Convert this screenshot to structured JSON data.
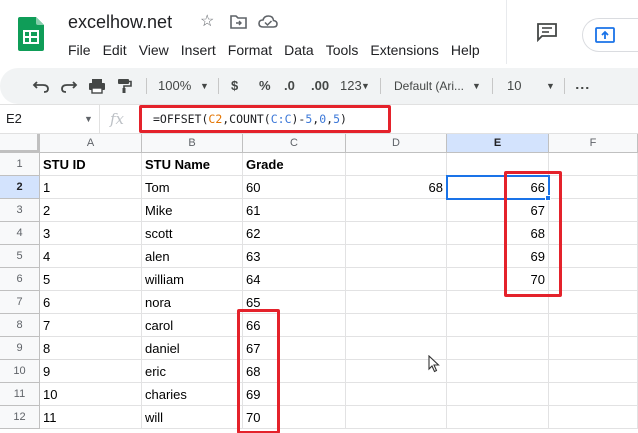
{
  "app": {
    "doc_title": "excelhow.net",
    "menu": [
      "File",
      "Edit",
      "View",
      "Insert",
      "Format",
      "Data",
      "Tools",
      "Extensions",
      "Help"
    ],
    "icons": [
      "sheets-logo-icon",
      "star-icon",
      "move-folder-icon",
      "cloud-status-icon",
      "comment-icon",
      "present-icon"
    ]
  },
  "toolbar": {
    "zoom": "100%",
    "currency": "$",
    "percent": "%",
    "decrease_decimal": ".0",
    "increase_decimal": ".00",
    "number_format": "123",
    "font": "Default (Ari...",
    "font_size": "10",
    "more": "⋮"
  },
  "formula_bar": {
    "cell_ref": "E2",
    "fx": "fx",
    "formula_parts": [
      {
        "text": "=OFFSET(",
        "color": "#202124"
      },
      {
        "text": "C2",
        "color": "#e37400"
      },
      {
        "text": ",COUNT(",
        "color": "#202124"
      },
      {
        "text": "C:C",
        "color": "#3c78d8"
      },
      {
        "text": ")-",
        "color": "#202124"
      },
      {
        "text": "5",
        "color": "#3c78d8"
      },
      {
        "text": ",",
        "color": "#202124"
      },
      {
        "text": "0",
        "color": "#3c78d8"
      },
      {
        "text": ",",
        "color": "#202124"
      },
      {
        "text": "5",
        "color": "#3c78d8"
      },
      {
        "text": ")",
        "color": "#202124"
      }
    ]
  },
  "sheet": {
    "columns": [
      "A",
      "B",
      "C",
      "D",
      "E",
      "F"
    ],
    "selected_column": "E",
    "rows": [
      1,
      2,
      3,
      4,
      5,
      6,
      7,
      8,
      9,
      10,
      11,
      12
    ],
    "selected_row": 2,
    "headers": {
      "A": "STU ID",
      "B": "STU Name",
      "C": "Grade"
    },
    "data": [
      {
        "A": "1",
        "B": "Tom",
        "C": "60",
        "D": "68",
        "E": "66"
      },
      {
        "A": "2",
        "B": "Mike",
        "C": "61",
        "E": "67"
      },
      {
        "A": "3",
        "B": "scott",
        "C": "62",
        "E": "68"
      },
      {
        "A": "4",
        "B": "alen",
        "C": "63",
        "E": "69"
      },
      {
        "A": "5",
        "B": "william",
        "C": "64",
        "E": "70"
      },
      {
        "A": "6",
        "B": "nora",
        "C": "65"
      },
      {
        "A": "7",
        "B": "carol",
        "C": "66"
      },
      {
        "A": "8",
        "B": "daniel",
        "C": "67"
      },
      {
        "A": "9",
        "B": "eric",
        "C": "68"
      },
      {
        "A": "10",
        "B": "charies",
        "C": "69"
      },
      {
        "A": "11",
        "B": "will",
        "C": "70"
      }
    ],
    "active_cell": "E2"
  },
  "colors": {
    "highlight": "#e4222b",
    "selection": "#1a73e8",
    "sheets_green": "#0f9d58"
  }
}
